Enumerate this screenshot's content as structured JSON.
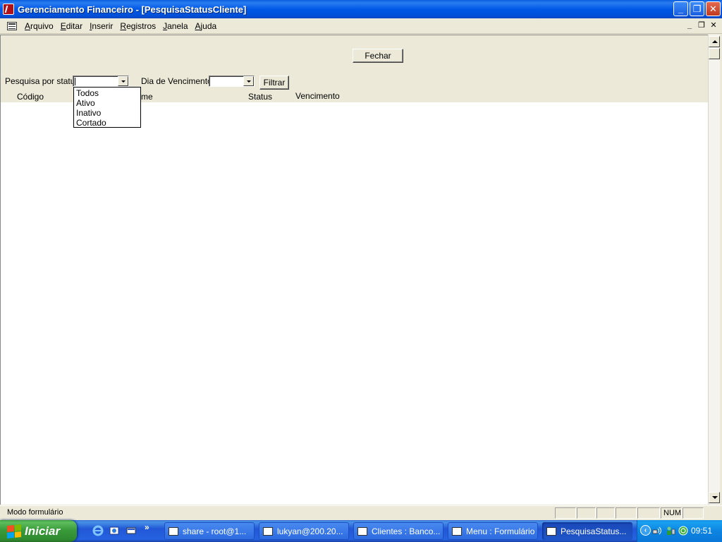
{
  "window": {
    "title": "Gerenciamento Financeiro - [PesquisaStatusCliente]",
    "minimize_glyph": "_",
    "restore_glyph": "❐",
    "close_glyph": "✕"
  },
  "menu": {
    "items": [
      {
        "accel": "A",
        "rest": "rquivo"
      },
      {
        "accel": "E",
        "rest": "ditar"
      },
      {
        "accel": "I",
        "rest": "nserir"
      },
      {
        "accel": "R",
        "rest": "egistros"
      },
      {
        "accel": "J",
        "rest": "anela"
      },
      {
        "accel": "A",
        "rest": "juda"
      }
    ],
    "mdi_minimize": "_",
    "mdi_restore": "❐",
    "mdi_close": "✕"
  },
  "form": {
    "close_button": "Fechar",
    "status_label": "Pesquisa por status",
    "status_value": "",
    "due_label": "Dia de Vencimento",
    "due_value": "",
    "filter_button": "Filtrar",
    "columns": {
      "code": "Código",
      "name_fragment": "me",
      "status": "Status",
      "due": "Vencimento"
    },
    "status_options": [
      "Todos",
      "Ativo",
      "Inativo",
      "Cortado"
    ]
  },
  "statusbar": {
    "mode": "Modo formulário",
    "num": "NUM"
  },
  "taskbar": {
    "start_label": "Iniciar",
    "tasks": [
      {
        "label": "share - root@1..."
      },
      {
        "label": "lukyan@200.20..."
      },
      {
        "label": "Clientes : Banco..."
      },
      {
        "label": "Menu : Formulário"
      },
      {
        "label": "PesquisaStatus..."
      }
    ],
    "overflow": "»",
    "clock": "09:51"
  },
  "colors": {
    "title_blue": "#0058e6",
    "start_green": "#3a9b3a",
    "face": "#ece9d8"
  }
}
